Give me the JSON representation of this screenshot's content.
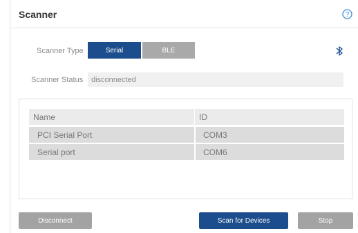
{
  "header": {
    "title": "Scanner",
    "help_icon": "help-circle-icon"
  },
  "scanner_type": {
    "label": "Scanner Type",
    "options": [
      "Serial",
      "BLE"
    ],
    "selected": "Serial",
    "bluetooth_icon": "bluetooth-icon"
  },
  "scanner_status": {
    "label": "Scanner Status",
    "value": "disconnected"
  },
  "devices": {
    "columns": [
      "Name",
      "ID"
    ],
    "rows": [
      {
        "name": "PCI Serial Port",
        "id": "COM3"
      },
      {
        "name": "Serial port",
        "id": "COM6"
      }
    ]
  },
  "actions": {
    "disconnect": "Disconnect",
    "scan": "Scan for Devices",
    "stop": "Stop"
  },
  "colors": {
    "primary": "#1c4d8c",
    "inactive": "#a3a3a3",
    "help": "#3b8ed8",
    "bluetooth": "#1c4d8c"
  }
}
